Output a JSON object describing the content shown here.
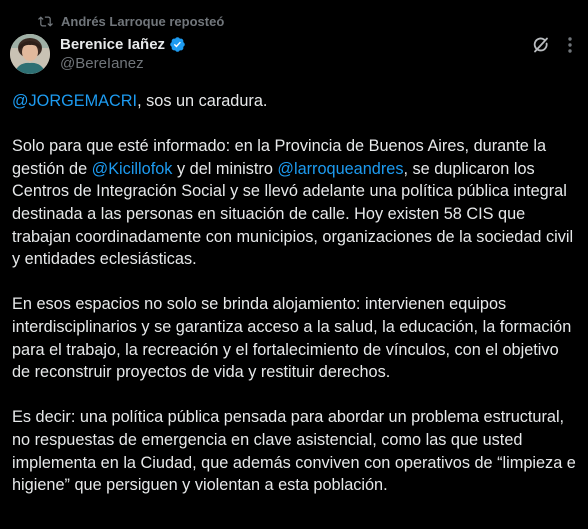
{
  "repost": {
    "text": "Andrés Larroque reposteó",
    "icon": "repost-icon"
  },
  "author": {
    "name": "Berenice Iañez",
    "handle": "@BereIanez",
    "verified": true,
    "badge_color": "#1d9bf0"
  },
  "actions": {
    "grok_icon": "grok-icon",
    "more_icon": "more-icon"
  },
  "tweet": {
    "p1": {
      "mention": "@JORGEMACRI",
      "rest": ", sos un caradura."
    },
    "p2": {
      "a": "Solo para que esté informado: en la Provincia de Buenos Aires, durante la gestión de ",
      "m1": "@Kicillofok",
      "b": " y del ministro ",
      "m2": "@larroqueandres",
      "c": ", se duplicaron los Centros de Integración Social y se llevó adelante una política pública integral destinada a las personas en situación de calle. Hoy existen 58 CIS que trabajan coordinadamente con municipios, organizaciones de la sociedad civil y entidades eclesiásticas."
    },
    "p3": "En esos espacios no solo se brinda alojamiento: intervienen equipos interdisciplinarios y se garantiza acceso a la salud, la educación, la formación para el trabajo, la recreación y el fortalecimiento de vínculos, con el objetivo de reconstruir proyectos de vida y restituir derechos.",
    "p4": "Es decir: una política pública pensada para abordar un problema estructural, no respuestas de emergencia en clave asistencial, como las que usted implementa en la Ciudad, que además conviven con operativos de “limpieza e higiene” que persiguen y violentan a esta población."
  },
  "colors": {
    "background": "#000000",
    "text": "#e7e9ea",
    "secondary": "#71767b",
    "link": "#1d9bf0"
  }
}
